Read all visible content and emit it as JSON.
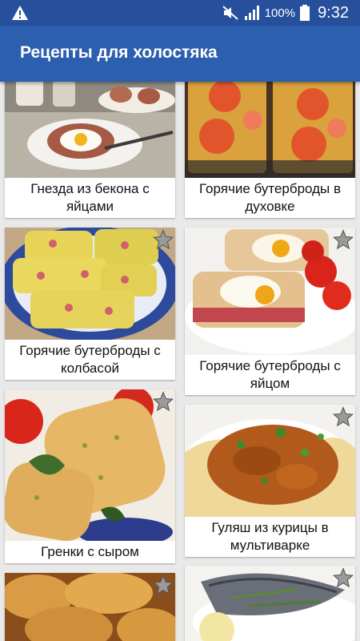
{
  "status": {
    "battery_percent": "100%",
    "time": "9:32",
    "icons": [
      "warning-icon",
      "mute-icon",
      "signal-icon",
      "battery-icon"
    ]
  },
  "app": {
    "title": "Рецепты для холостяка"
  },
  "recipes": [
    {
      "title": "Гнезда из бекона с яйцами"
    },
    {
      "title": "Горячие бутерброды в духовке"
    },
    {
      "title": "Горячие бутерброды с колбасой"
    },
    {
      "title": "Горячие бутерброды с яйцом"
    },
    {
      "title": "Гренки с сыром"
    },
    {
      "title": "Гуляш из курицы в мультиварке"
    },
    {
      "title": ""
    },
    {
      "title": ""
    }
  ],
  "colors": {
    "status_bar": "#26509c",
    "app_bar": "#2d5faf",
    "background": "#e9e9e9",
    "favorite_star": "#9a9a9a"
  }
}
